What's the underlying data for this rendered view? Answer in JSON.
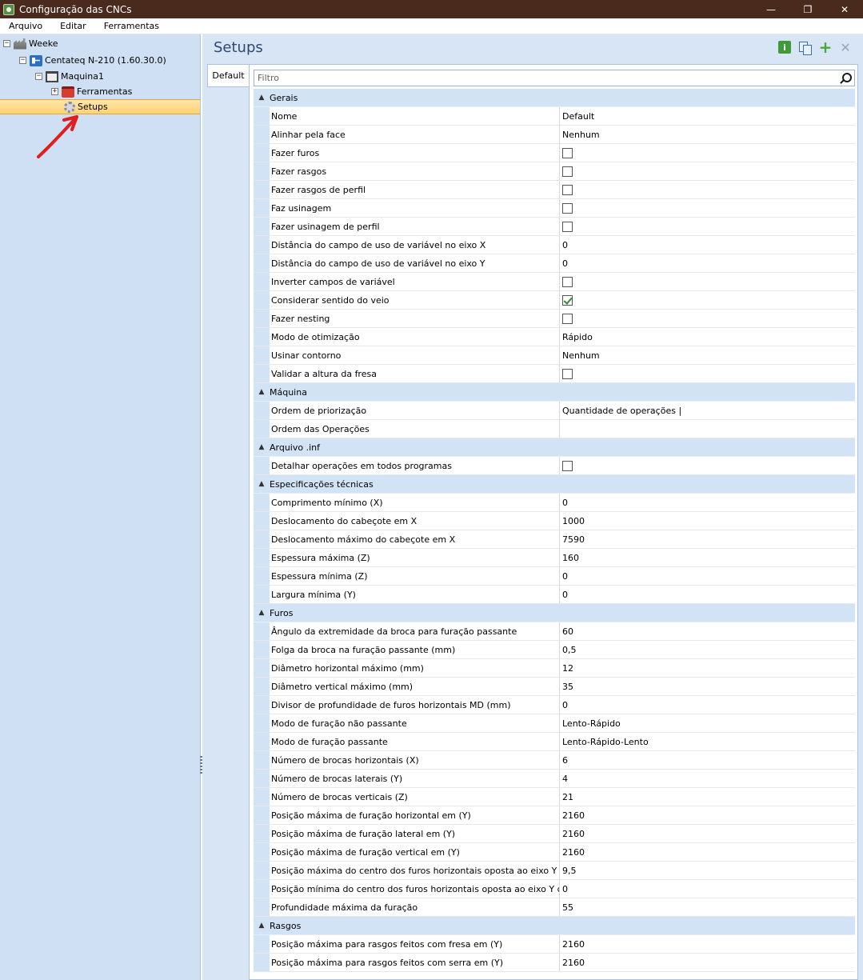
{
  "window": {
    "title": "Configuração das CNCs"
  },
  "menu": [
    "Arquivo",
    "Editar",
    "Ferramentas"
  ],
  "tree": {
    "root": "Weeke",
    "cnc": "Centateq N-210 (1.60.30.0)",
    "machine": "Maquina1",
    "tools": "Ferramentas",
    "setups": "Setups"
  },
  "main": {
    "title": "Setups",
    "tab": "Default",
    "filter_placeholder": "Filtro"
  },
  "grid": [
    {
      "category": "Gerais",
      "rows": [
        {
          "name": "Nome",
          "value": "Default"
        },
        {
          "name": "Alinhar pela face",
          "value": "Nenhum"
        },
        {
          "name": "Fazer furos",
          "checkbox": false
        },
        {
          "name": "Fazer rasgos",
          "checkbox": false
        },
        {
          "name": "Fazer rasgos de perfil",
          "checkbox": false
        },
        {
          "name": "Faz usinagem",
          "checkbox": false
        },
        {
          "name": "Fazer usinagem de perfil",
          "checkbox": false
        },
        {
          "name": "Distância do campo de uso de variável no eixo X",
          "value": "0"
        },
        {
          "name": "Distância do campo de uso de variável no eixo Y",
          "value": "0"
        },
        {
          "name": "Inverter campos de variável",
          "checkbox": false
        },
        {
          "name": "Considerar sentido do veio",
          "checkbox": true
        },
        {
          "name": "Fazer nesting",
          "checkbox": false
        },
        {
          "name": "Modo de otimização",
          "value": "Rápido"
        },
        {
          "name": "Usinar contorno",
          "value": "Nenhum"
        },
        {
          "name": "Validar a altura da fresa",
          "checkbox": false
        }
      ]
    },
    {
      "category": "Máquina",
      "rows": [
        {
          "name": "Ordem de priorização",
          "value": "Quantidade de operações |"
        },
        {
          "name": "Ordem das Operações",
          "value": ""
        }
      ]
    },
    {
      "category": "Arquivo .inf",
      "rows": [
        {
          "name": "Detalhar operações em todos programas",
          "checkbox": false
        }
      ]
    },
    {
      "category": "Especificações técnicas",
      "rows": [
        {
          "name": "Comprimento mínimo (X)",
          "value": "0"
        },
        {
          "name": "Deslocamento do cabeçote em X",
          "value": "1000"
        },
        {
          "name": "Deslocamento máximo do cabeçote em X",
          "value": "7590"
        },
        {
          "name": "Espessura máxima (Z)",
          "value": "160"
        },
        {
          "name": "Espessura mínima (Z)",
          "value": "0"
        },
        {
          "name": "Largura mínima (Y)",
          "value": "0"
        }
      ]
    },
    {
      "category": "Furos",
      "rows": [
        {
          "name": "Ângulo da extremidade da broca para furação passante",
          "value": "60"
        },
        {
          "name": "Folga da broca na furação passante (mm)",
          "value": "0,5"
        },
        {
          "name": "Diâmetro horizontal máximo (mm)",
          "value": "12"
        },
        {
          "name": "Diâmetro vertical máximo (mm)",
          "value": "35"
        },
        {
          "name": "Divisor de profundidade de furos horizontais MD (mm)",
          "value": "0"
        },
        {
          "name": "Modo de furação não passante",
          "value": "Lento-Rápido"
        },
        {
          "name": "Modo de furação passante",
          "value": "Lento-Rápido-Lento"
        },
        {
          "name": "Número de brocas horizontais (X)",
          "value": "6"
        },
        {
          "name": "Número de brocas laterais (Y)",
          "value": "4"
        },
        {
          "name": "Número de brocas verticais (Z)",
          "value": "21"
        },
        {
          "name": "Posição máxima de furação horizontal em (Y)",
          "value": "2160"
        },
        {
          "name": "Posição máxima de furação lateral em (Y)",
          "value": "2160"
        },
        {
          "name": "Posição máxima de furação vertical em (Y)",
          "value": "2160"
        },
        {
          "name": "Posição máxima do centro dos furos horizontais oposta ao eixo Y da fa...",
          "value": "9,5"
        },
        {
          "name": "Posição mínima do centro dos furos horizontais oposta ao eixo Y da fa...",
          "value": "0"
        },
        {
          "name": "Profundidade máxima da furação",
          "value": "55"
        }
      ]
    },
    {
      "category": "Rasgos",
      "rows": [
        {
          "name": "Posição máxima para rasgos feitos com fresa em (Y)",
          "value": "2160"
        },
        {
          "name": "Posição máxima para rasgos feitos com serra em (Y)",
          "value": "2160"
        }
      ]
    }
  ]
}
